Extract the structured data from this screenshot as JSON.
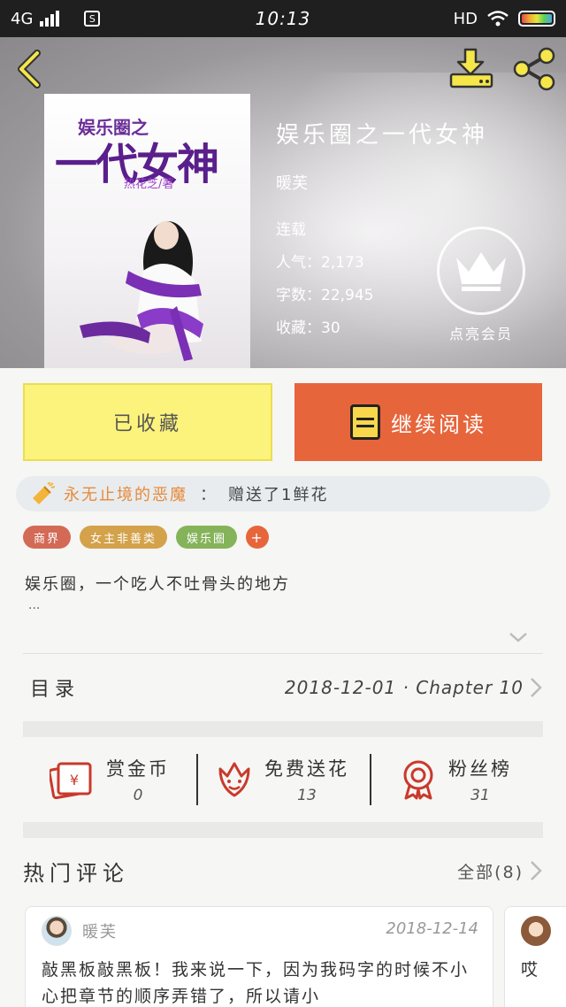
{
  "status_bar": {
    "network": "4G",
    "sim_icon": "S",
    "time": "10:13",
    "hd": "HD"
  },
  "book": {
    "cover_title_small": "娱乐圈之",
    "cover_title_big": "一代女神",
    "cover_author_art": "热花芝/著",
    "title": "娱乐圈之一代女神",
    "author": "暖芙",
    "status": "连载",
    "popularity": "人气：2,173",
    "word_count": "字数：22,945",
    "favorites": "收藏：30"
  },
  "vip": {
    "label": "点亮会员",
    "icon": "crown-icon"
  },
  "actions": {
    "collected_label": "已收藏",
    "read_label": "继续阅读"
  },
  "gift_notice": {
    "user": "永无止境的恶魔",
    "separator": "：",
    "action": "赠送了1鲜花"
  },
  "tags": [
    {
      "label": "商界",
      "color": "#d36a56"
    },
    {
      "label": "女主非善类",
      "color": "#d3a24a"
    },
    {
      "label": "娱乐圈",
      "color": "#85b35a"
    },
    {
      "label": "+",
      "color": "#e7653b"
    }
  ],
  "description": {
    "text": "娱乐圈，一个吃人不吐骨头的地方",
    "ellipsis": "..."
  },
  "toc": {
    "label": "目录",
    "latest": "2018-12-01 · Chapter 10"
  },
  "stats": [
    {
      "name": "赏金币",
      "value": "0",
      "icon": "red-envelope-icon"
    },
    {
      "name": "免费送花",
      "value": "13",
      "icon": "flower-icon"
    },
    {
      "name": "粉丝榜",
      "value": "31",
      "icon": "medal-icon"
    }
  ],
  "comments": {
    "heading": "热门评论",
    "all_label": "全部(8)",
    "items": [
      {
        "user": "暖芙",
        "date": "2018-12-14",
        "text": "敲黑板敲黑板！我来说一下，因为我码字的时候不小心把章节的顺序弄错了，所以请小"
      },
      {
        "text": "哎"
      }
    ]
  },
  "colors": {
    "accent": "#e7653b",
    "collected_bg": "#fcf37c",
    "header_icon": "#f5e64a"
  }
}
